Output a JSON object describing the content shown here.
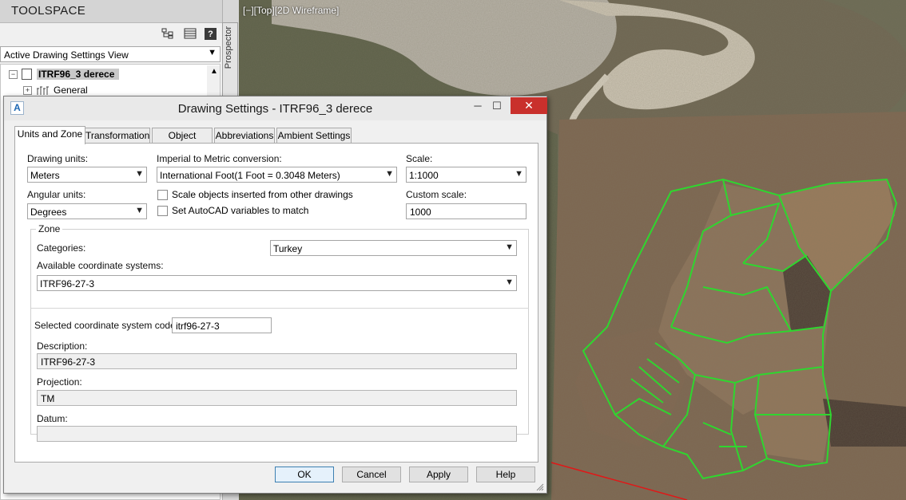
{
  "viewport": {
    "label": "[−][Top][2D Wireframe]"
  },
  "toolspace": {
    "title": "TOOLSPACE",
    "help_label": "?",
    "side_tab_label": "Prospector",
    "view_select": "Active Drawing Settings View",
    "tree": {
      "root_label": "ITRF96_3 derece",
      "child_label": "General",
      "expand_minus": "−",
      "expand_plus": "+"
    }
  },
  "dialog": {
    "title": "Drawing Settings - ITRF96_3 derece",
    "logo_letter": "A",
    "tabs": [
      {
        "label": "Units and Zone"
      },
      {
        "label": "Transformation"
      },
      {
        "label": "Object Layers"
      },
      {
        "label": "Abbreviations"
      },
      {
        "label": "Ambient Settings"
      }
    ],
    "units": {
      "drawing_units_label": "Drawing units:",
      "drawing_units_value": "Meters",
      "imperial_label": "Imperial to Metric conversion:",
      "imperial_value": "International Foot(1 Foot = 0.3048 Meters)",
      "scale_label": "Scale:",
      "scale_value": "1:1000",
      "angular_label": "Angular units:",
      "angular_value": "Degrees",
      "scale_objects_label": "Scale objects inserted from other drawings",
      "set_autocad_label": "Set AutoCAD variables to match",
      "custom_scale_label": "Custom scale:",
      "custom_scale_value": "1000"
    },
    "zone": {
      "group_label": "Zone",
      "categories_label": "Categories:",
      "categories_value": "Turkey",
      "available_label": "Available coordinate systems:",
      "available_value": "ITRF96-27-3",
      "selected_code_label": "Selected coordinate system code:",
      "selected_code_value": "itrf96-27-3",
      "description_label": "Description:",
      "description_value": "ITRF96-27-3",
      "projection_label": "Projection:",
      "projection_value": "TM",
      "datum_label": "Datum:",
      "datum_value": ""
    },
    "buttons": {
      "ok": "OK",
      "cancel": "Cancel",
      "apply": "Apply",
      "help": "Help"
    }
  },
  "colors": {
    "parcel_outline": "#2fd62f",
    "close_button": "#c9302c",
    "terrain_field": "#8a6f52",
    "mine_pale": "#b8b3a8"
  }
}
